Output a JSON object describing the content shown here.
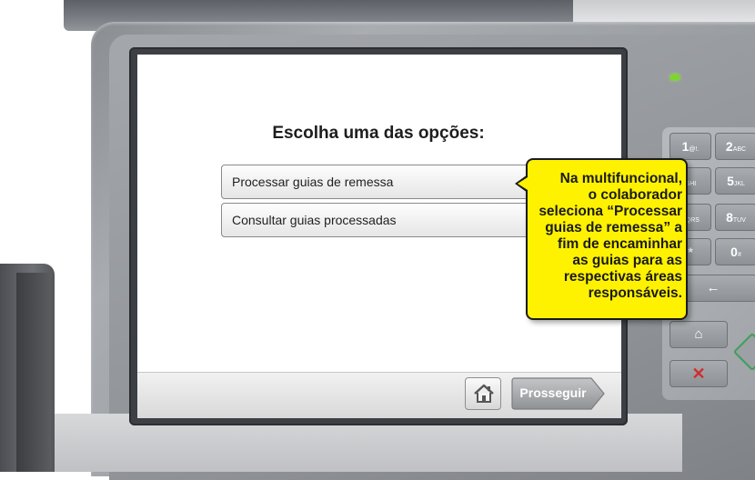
{
  "screen": {
    "prompt": "Escolha uma das opções:",
    "options": [
      {
        "label": "Processar guias de remessa",
        "selected": true
      },
      {
        "label": "Consultar guias processadas",
        "selected": false
      }
    ],
    "footer": {
      "home_icon": "home-icon",
      "continue_label": "Prosseguir"
    }
  },
  "keypad": {
    "keys": [
      {
        "main": "1",
        "sub": "@!."
      },
      {
        "main": "2",
        "sub": "ABC"
      },
      {
        "main": "",
        "sub": "GHI"
      },
      {
        "main": "5",
        "sub": "JKL"
      },
      {
        "main": "",
        "sub": "PQRS"
      },
      {
        "main": "8",
        "sub": "TUV"
      },
      {
        "main": "*",
        "sub": ""
      },
      {
        "main": "0",
        "sub": "#"
      },
      {
        "main": "←",
        "sub": ""
      },
      {
        "main": "⌂",
        "sub": ""
      },
      {
        "main": "✕",
        "sub": ""
      }
    ]
  },
  "callout": {
    "lines": [
      "Na multifuncional,",
      "o colaborador",
      "seleciona “Processar",
      "guias de remessa” a",
      "fim de encaminhar",
      "as guias para as",
      "respectivas áreas",
      "responsáveis."
    ],
    "color": "#fff200"
  },
  "colors": {
    "selected_radio_bg": "#2d78c8",
    "indicator_led": "#7cd62b"
  }
}
